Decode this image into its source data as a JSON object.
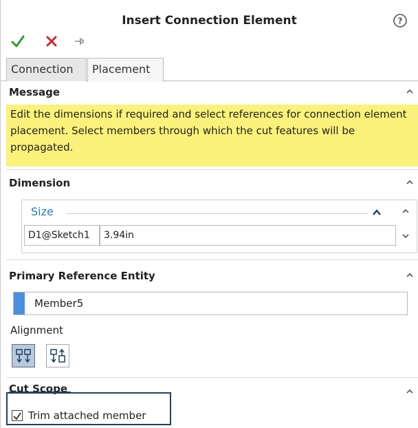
{
  "dialog": {
    "title": "Insert Connection Element"
  },
  "tabs": [
    {
      "label": "Connection",
      "active": false
    },
    {
      "label": "Placement",
      "active": true
    }
  ],
  "message": {
    "header": "Message",
    "text": "Edit the dimensions if required and select references for connection element placement. Select members through which the cut features will be propagated."
  },
  "dimension": {
    "header": "Dimension",
    "group_label": "Size",
    "row": {
      "name": "D1@Sketch1",
      "value": "3.94in"
    }
  },
  "primary_reference": {
    "header": "Primary Reference Entity",
    "value": "Member5",
    "alignment_label": "Alignment"
  },
  "cut_scope": {
    "header": "Cut Scope",
    "checkbox_label": "Trim attached member",
    "checked": true
  },
  "icons": {
    "help": "help-icon",
    "ok": "checkmark-icon",
    "cancel": "close-icon",
    "pin": "pushpin-icon"
  },
  "colors": {
    "message_bg": "#faf27a",
    "ok_green": "#2e9b2e",
    "cancel_red": "#d42626",
    "accent_blue": "#2a78c3",
    "highlight_border": "#1e3f66"
  }
}
